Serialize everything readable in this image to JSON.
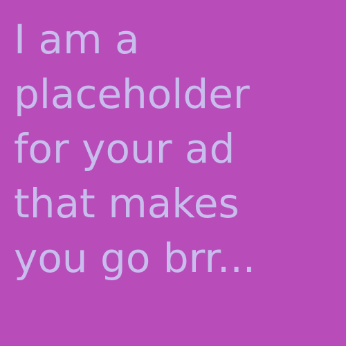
{
  "ad": {
    "background": "#b84dba",
    "text_color": "#c8bdec",
    "lines": [
      "I am a",
      "placeholder",
      "for your ad",
      "that makes",
      "you go brr..."
    ]
  }
}
